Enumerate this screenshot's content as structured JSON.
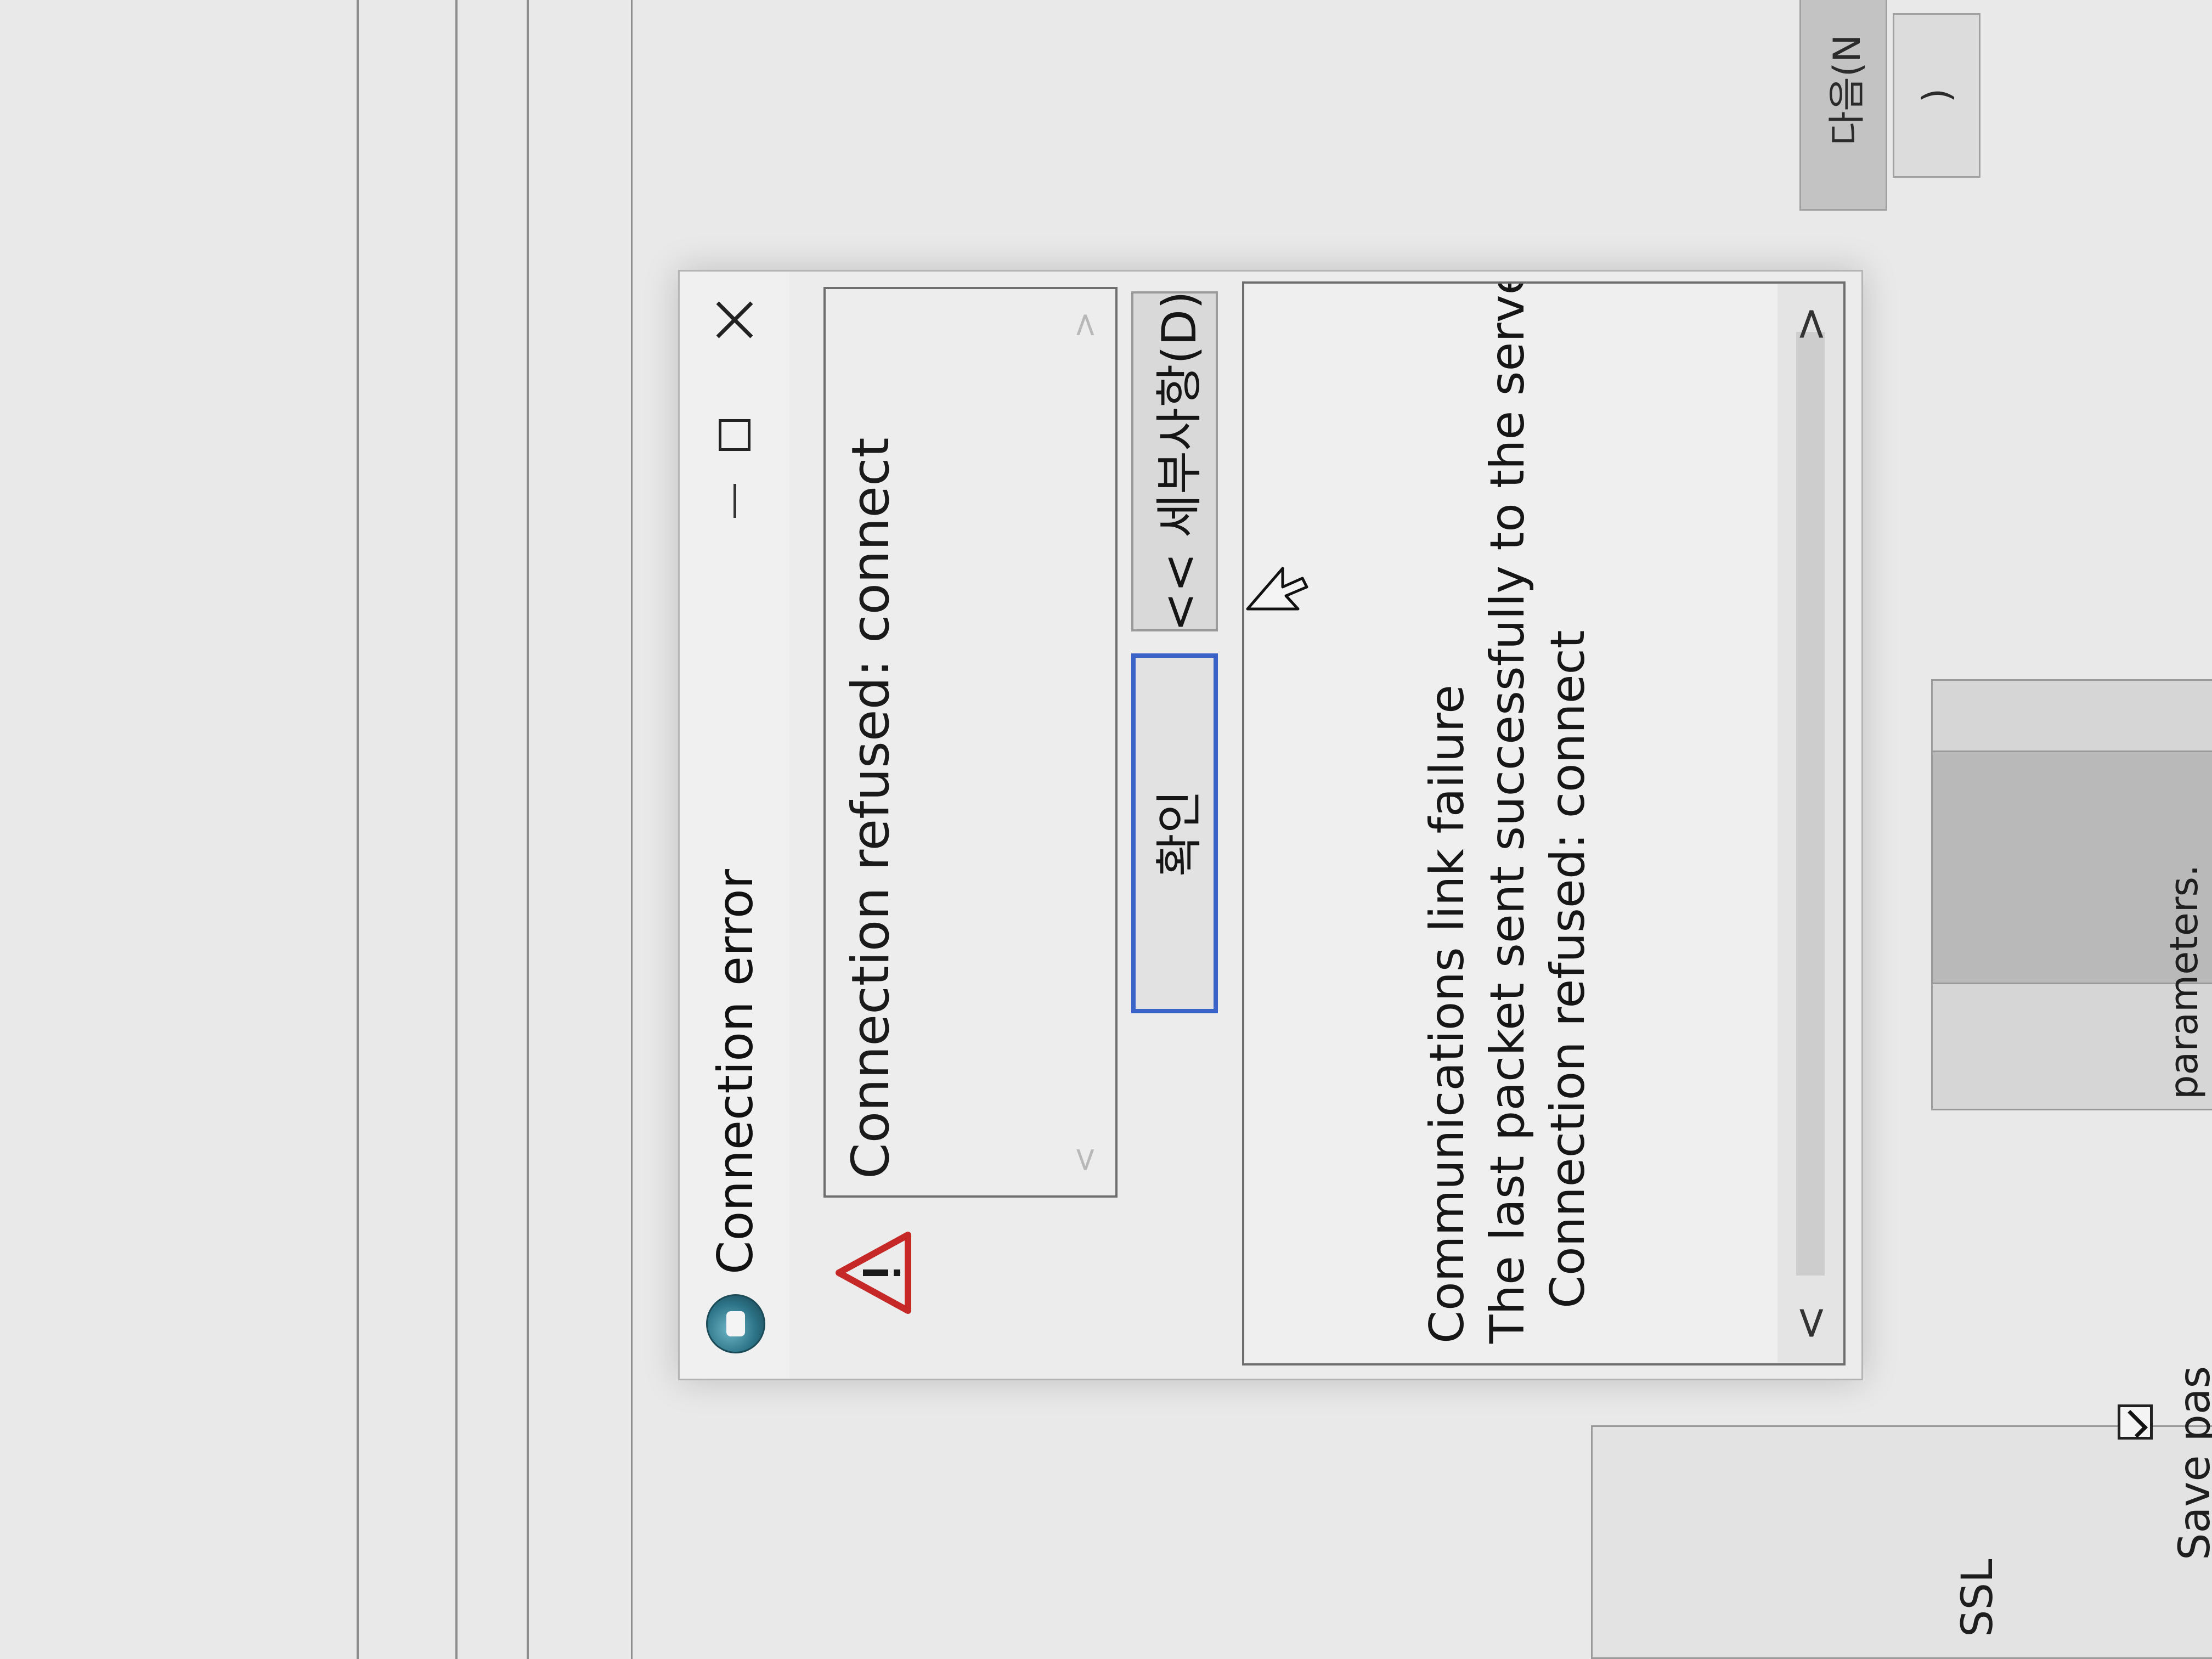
{
  "background": {
    "ssl_label": "SSL",
    "save_password_label": "Save pas",
    "parameters_label": "parameters.",
    "next_button_label": "다음(N",
    "prev_button_partial": ")"
  },
  "dialog": {
    "title": "Connection error",
    "message": "Connection refused: connect",
    "ok_label": "확인",
    "details_label": "<< 세부사항(D)",
    "details": {
      "line1": "Communications link failure",
      "line2": "The last packet sent successfully to the server was",
      "line3": "Connection refused: connect"
    },
    "scroll_left": "<",
    "scroll_right": ">"
  },
  "icons": {
    "app": "app-logo-icon",
    "warning": "warning-icon",
    "minimize": "minimize-icon",
    "maximize": "maximize-icon",
    "close": "close-icon",
    "cursor": "mouse-cursor-icon"
  },
  "colors": {
    "warning": "#c62828",
    "ok_focus_border": "#3a64c8"
  }
}
